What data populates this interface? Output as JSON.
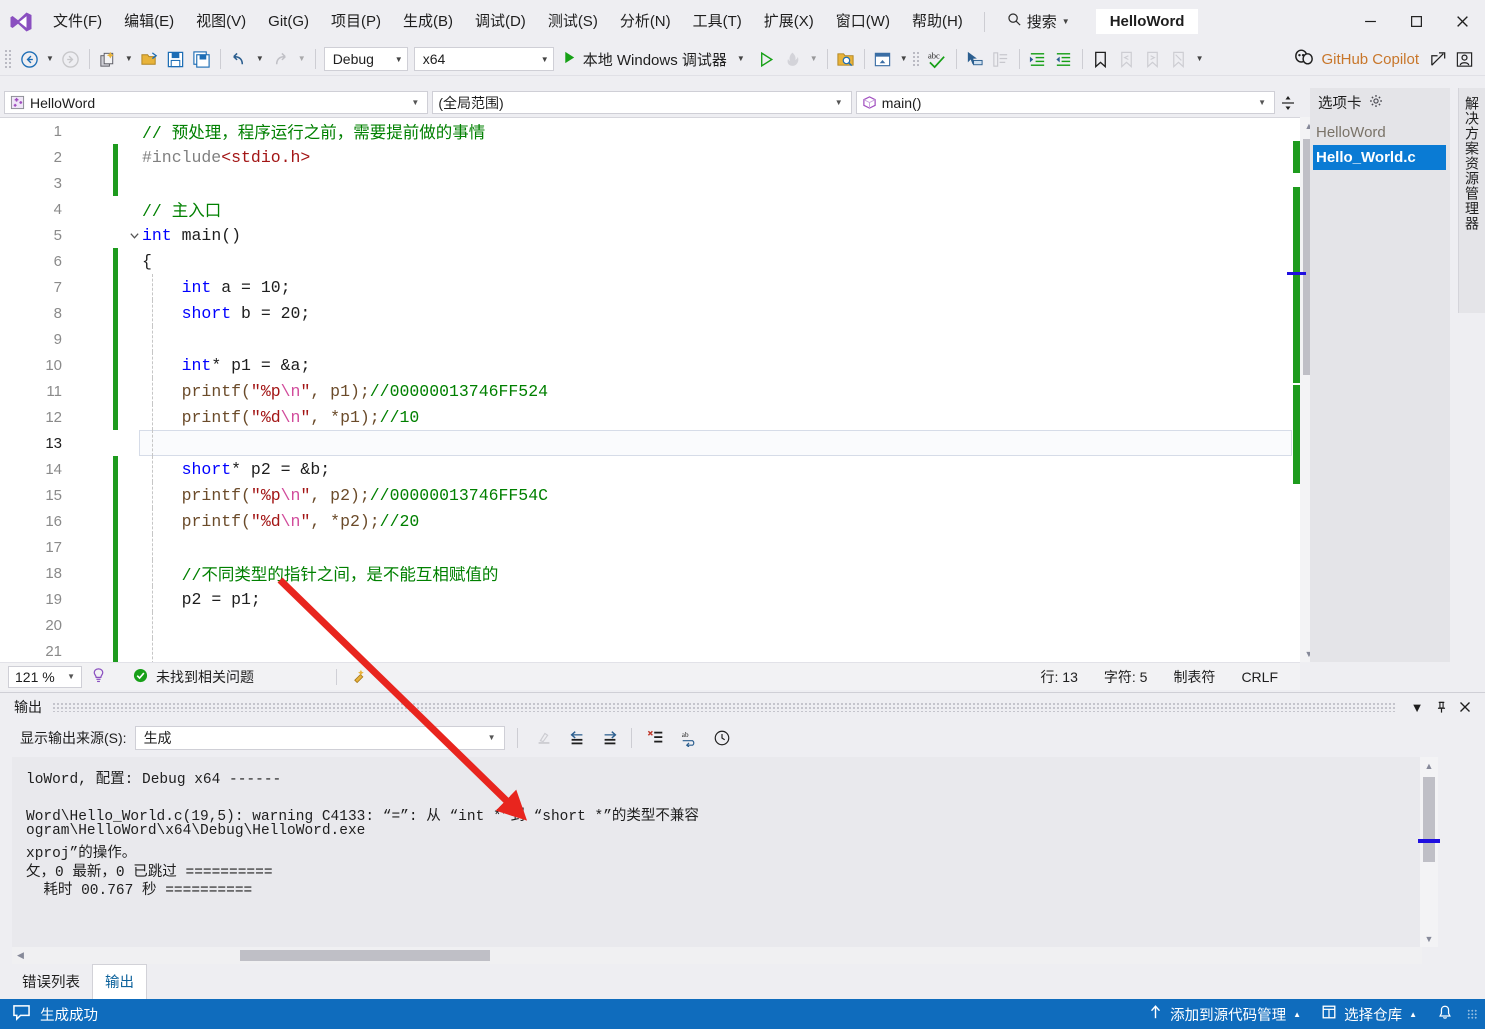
{
  "titlebar": {
    "logo_icon": "visual-studio-logo-icon",
    "menus": [
      {
        "label": "文件(F)"
      },
      {
        "label": "编辑(E)"
      },
      {
        "label": "视图(V)"
      },
      {
        "label": "Git(G)"
      },
      {
        "label": "项目(P)"
      },
      {
        "label": "生成(B)"
      },
      {
        "label": "调试(D)"
      },
      {
        "label": "测试(S)"
      },
      {
        "label": "分析(N)"
      },
      {
        "label": "工具(T)"
      },
      {
        "label": "扩展(X)"
      },
      {
        "label": "窗口(W)"
      },
      {
        "label": "帮助(H)"
      }
    ],
    "search_label": "搜索",
    "search_icon": "search-icon",
    "window_title": "HelloWord",
    "minimize_label": "─",
    "maximize_label": "☐",
    "close_label": "✕"
  },
  "toolbar": {
    "nav_back_icon": "navigate-back-icon",
    "nav_forward_icon": "navigate-forward-icon",
    "new_item_icon": "new-item-icon",
    "open_file_icon": "open-file-icon",
    "save_icon": "save-icon",
    "save_all_icon": "save-all-icon",
    "undo_icon": "undo-icon",
    "redo_icon": "redo-icon",
    "configuration": "Debug",
    "platform": "x64",
    "run_label": "本地 Windows 调试器",
    "run_icon": "run-play-icon",
    "start_without_debug_icon": "start-without-debugging-icon",
    "hot_reload_icon": "hot-reload-icon",
    "find_in_files_icon": "find-in-files-icon",
    "window_layout_icon": "window-layout-icon",
    "spellcheck_icon": "spellcheck-abc-icon",
    "pointer_select_icon": "pointer-select-icon",
    "comment_icon": "comment-lines-icon",
    "indent_icon": "increase-indent-icon",
    "outdent_icon": "decrease-indent-icon",
    "bookmark_icon": "bookmark-icon",
    "bookmark_prev_icon": "bookmark-previous-icon",
    "bookmark_next_icon": "bookmark-next-icon",
    "bookmark_clear_icon": "bookmark-clear-icon",
    "overflow_icon": "toolbar-overflow-icon",
    "copilot_label": "GitHub Copilot",
    "copilot_icon": "github-copilot-icon",
    "share_icon": "share-icon",
    "account_icon": "account-icon"
  },
  "navbar": {
    "project": "HelloWord",
    "project_icon": "cpp-project-icon",
    "scope": "(全局范围)",
    "member": "main()",
    "member_icon": "method-cube-icon",
    "splitter_icon": "split-window-icon"
  },
  "editor": {
    "lines": [
      {
        "n": "1",
        "change": "none",
        "fold": "",
        "indent": 0,
        "tokens": [
          {
            "t": "// 预处理，程序运行之前，需要提前做的事情",
            "c": "c-com"
          }
        ]
      },
      {
        "n": "2",
        "change": "green",
        "fold": "",
        "indent": 0,
        "tokens": [
          {
            "t": "#include",
            "c": "c-pre"
          },
          {
            "t": "<stdio.h>",
            "c": "c-inc"
          }
        ]
      },
      {
        "n": "3",
        "change": "green",
        "fold": "",
        "indent": 0,
        "tokens": []
      },
      {
        "n": "4",
        "change": "none",
        "fold": "",
        "indent": 0,
        "tokens": [
          {
            "t": "// 主入口",
            "c": "c-com"
          }
        ]
      },
      {
        "n": "5",
        "change": "none",
        "fold": "v",
        "indent": 0,
        "tokens": [
          {
            "t": "int",
            "c": "c-key"
          },
          {
            "t": " main()",
            "c": "c-pln"
          }
        ]
      },
      {
        "n": "6",
        "change": "green",
        "fold": "",
        "indent": 0,
        "tokens": [
          {
            "t": "{",
            "c": "c-pln"
          }
        ]
      },
      {
        "n": "7",
        "change": "green",
        "fold": "",
        "indent": 1,
        "tokens": [
          {
            "t": "int",
            "c": "c-key"
          },
          {
            "t": " a = 10;",
            "c": "c-pln"
          }
        ]
      },
      {
        "n": "8",
        "change": "green",
        "fold": "",
        "indent": 1,
        "tokens": [
          {
            "t": "short",
            "c": "c-key"
          },
          {
            "t": " b = 20;",
            "c": "c-pln"
          }
        ]
      },
      {
        "n": "9",
        "change": "green",
        "fold": "",
        "indent": 1,
        "tokens": []
      },
      {
        "n": "10",
        "change": "green",
        "fold": "",
        "indent": 1,
        "tokens": [
          {
            "t": "int",
            "c": "c-key"
          },
          {
            "t": "* p1 = &a;",
            "c": "c-pln"
          }
        ]
      },
      {
        "n": "11",
        "change": "green",
        "fold": "",
        "indent": 1,
        "tokens": [
          {
            "t": "printf(",
            "c": "c-fn"
          },
          {
            "t": "\"%p",
            "c": "c-str"
          },
          {
            "t": "\\n",
            "c": "c-esc"
          },
          {
            "t": "\"",
            "c": "c-str"
          },
          {
            "t": ", p1);",
            "c": "c-fn"
          },
          {
            "t": "//00000013746FF524",
            "c": "c-com"
          }
        ]
      },
      {
        "n": "12",
        "change": "green",
        "fold": "",
        "indent": 1,
        "tokens": [
          {
            "t": "printf(",
            "c": "c-fn"
          },
          {
            "t": "\"%d",
            "c": "c-str"
          },
          {
            "t": "\\n",
            "c": "c-esc"
          },
          {
            "t": "\"",
            "c": "c-str"
          },
          {
            "t": ", *p1);",
            "c": "c-fn"
          },
          {
            "t": "//10",
            "c": "c-com"
          }
        ]
      },
      {
        "n": "13",
        "change": "none",
        "fold": "",
        "indent": 1,
        "tokens": [],
        "current": true
      },
      {
        "n": "14",
        "change": "green",
        "fold": "",
        "indent": 1,
        "tokens": [
          {
            "t": "short",
            "c": "c-key"
          },
          {
            "t": "* p2 = &b;",
            "c": "c-pln"
          }
        ]
      },
      {
        "n": "15",
        "change": "green",
        "fold": "",
        "indent": 1,
        "tokens": [
          {
            "t": "printf(",
            "c": "c-fn"
          },
          {
            "t": "\"%p",
            "c": "c-str"
          },
          {
            "t": "\\n",
            "c": "c-esc"
          },
          {
            "t": "\"",
            "c": "c-str"
          },
          {
            "t": ", p2);",
            "c": "c-fn"
          },
          {
            "t": "//00000013746FF54C",
            "c": "c-com"
          }
        ]
      },
      {
        "n": "16",
        "change": "green",
        "fold": "",
        "indent": 1,
        "tokens": [
          {
            "t": "printf(",
            "c": "c-fn"
          },
          {
            "t": "\"%d",
            "c": "c-str"
          },
          {
            "t": "\\n",
            "c": "c-esc"
          },
          {
            "t": "\"",
            "c": "c-str"
          },
          {
            "t": ", *p2);",
            "c": "c-fn"
          },
          {
            "t": "//20",
            "c": "c-com"
          }
        ]
      },
      {
        "n": "17",
        "change": "green",
        "fold": "",
        "indent": 1,
        "tokens": []
      },
      {
        "n": "18",
        "change": "green",
        "fold": "",
        "indent": 1,
        "tokens": [
          {
            "t": "//不同类型的指针之间，是不能互相赋值的",
            "c": "c-com"
          }
        ]
      },
      {
        "n": "19",
        "change": "green",
        "fold": "",
        "indent": 1,
        "tokens": [
          {
            "t": "p2 = p1;",
            "c": "c-pln"
          }
        ]
      },
      {
        "n": "20",
        "change": "green",
        "fold": "",
        "indent": 1,
        "tokens": []
      },
      {
        "n": "21",
        "change": "green",
        "fold": "",
        "indent": 1,
        "tokens": []
      }
    ]
  },
  "editor_status": {
    "zoom": "121 %",
    "intellisense_icon": "intellisense-lightbulb-icon",
    "problem_status_icon": "status-ok-icon",
    "problem_status": "未找到相关问题",
    "tools_icon": "code-cleanup-icon",
    "line_label": "行: 13",
    "col_label": "字符: 5",
    "tab_label": "制表符",
    "eol_label": "CRLF"
  },
  "output": {
    "title": "输出",
    "dropdown_icon": "chevron-down-icon",
    "pin_icon": "pin-icon",
    "close_icon": "close-icon",
    "source_label": "显示输出来源(S):",
    "source_value": "生成",
    "btn_clear_icon": "clear-all-icon",
    "btn_prev_icon": "go-to-previous-message-icon",
    "btn_next_icon": "go-to-next-message-icon",
    "btn_clear_pane_icon": "clear-pane-icon",
    "btn_wordwrap_icon": "toggle-word-wrap-icon",
    "btn_history_icon": "output-history-icon",
    "lines": [
      "loWord, 配置: Debug x64 ------",
      "",
      "Word\\Hello_World.c(19,5): warning C4133: “=”: 从 “int *”到 “short *”的类型不兼容",
      "ogram\\HelloWord\\x64\\Debug\\HelloWord.exe",
      "xproj”的操作。",
      "攵，0 最新，0 已跳过 ==========",
      "  耗时 00.767 秒 =========="
    ]
  },
  "bottom_tabs": [
    {
      "label": "错误列表",
      "active": false
    },
    {
      "label": "输出",
      "active": true
    }
  ],
  "statusbar": {
    "build_icon": "build-result-icon",
    "build_status": "生成成功",
    "source_control_icon": "add-to-source-control-icon",
    "source_control_label": "添加到源代码管理",
    "source_control_caret": "▲",
    "repo_icon": "select-repository-icon",
    "repo_label": "选择仓库",
    "repo_caret": "▲",
    "notification_icon": "notification-bell-icon"
  },
  "solution": {
    "header": "选项卡",
    "header_gear_icon": "gear-icon",
    "items": [
      {
        "label": "HelloWord",
        "selected": false
      },
      {
        "label": "Hello_World.c",
        "selected": true
      }
    ],
    "vertical_tab": "解决方案资源管理器"
  },
  "colors": {
    "accent_blue": "#0F6CBD",
    "selection_blue": "#0A7BD4",
    "comment_green": "#008000",
    "keyword_blue": "#0000FF",
    "string_red": "#A31515",
    "change_bar_green": "#1E9B1E",
    "copilot_orange": "#C8762A",
    "annotation_red": "#E8251E"
  }
}
